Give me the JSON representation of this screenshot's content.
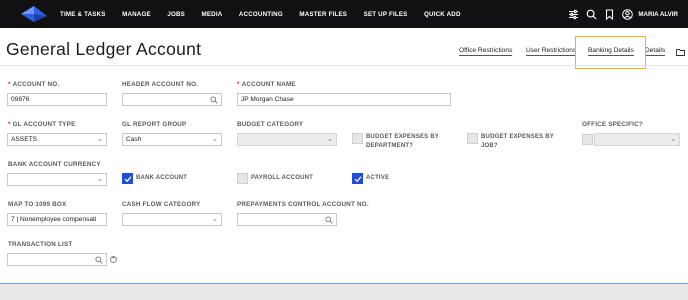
{
  "nav": {
    "menu": [
      "TIME & TASKS",
      "MANAGE",
      "JOBS",
      "MEDIA",
      "ACCOUNTING",
      "MASTER FILES",
      "SET UP FILES",
      "QUICK ADD"
    ],
    "user_name": "MARIA ALVIR",
    "icons": [
      "sliders-icon",
      "search-icon",
      "bookmark-icon",
      "user-circle-icon"
    ]
  },
  "page": {
    "title": "General Ledger Account"
  },
  "tabs": [
    "Office Restrictions",
    "User Restrictions",
    "Banking Details",
    "Details"
  ],
  "form": {
    "account_no": {
      "label": "ACCOUNT NO.",
      "value": "09876"
    },
    "header_account_no": {
      "label": "HEADER ACCOUNT NO.",
      "value": ""
    },
    "account_name": {
      "label": "ACCOUNT NAME",
      "value": "JP Morgan Chase"
    },
    "gl_account_type": {
      "label": "GL ACCOUNT TYPE",
      "value": "ASSETS"
    },
    "gl_report_group": {
      "label": "GL REPORT GROUP",
      "value": "Cash"
    },
    "budget_category": {
      "label": "BUDGET CATEGORY",
      "value": ""
    },
    "budget_expenses_by_department": {
      "label_line1": "BUDGET EXPENSES BY",
      "label_line2": "DEPARTMENT?",
      "checked": false
    },
    "budget_expenses_by_job": {
      "label_line1": "BUDGET EXPENSES BY",
      "label_line2": "JOB?",
      "checked": false
    },
    "office_specific": {
      "label": "OFFICE SPECIFIC?",
      "checked": false
    },
    "bank_account_currency": {
      "label": "BANK ACCOUNT CURRENCY",
      "value": ""
    },
    "bank_account": {
      "label": "BANK ACCOUNT",
      "checked": true
    },
    "payroll_account": {
      "label": "PAYROLL ACCOUNT",
      "checked": false
    },
    "active": {
      "label": "ACTIVE",
      "checked": true
    },
    "map_to_1099_box": {
      "label": "MAP TO 1099 BOX",
      "value": "7 | Nonemployee compensati"
    },
    "cash_flow_category": {
      "label": "CASH FLOW CATEGORY",
      "value": ""
    },
    "prepayments_control_account_no": {
      "label": "PREPAYMENTS CONTROL ACCOUNT NO.",
      "value": ""
    },
    "transaction_list": {
      "label": "TRANSACTION LIST",
      "value": ""
    }
  },
  "colors": {
    "nav_bg": "#111114",
    "accent_blue": "#1f4ed6",
    "required_red": "#e02020",
    "tab_highlight": "#f3b500"
  }
}
